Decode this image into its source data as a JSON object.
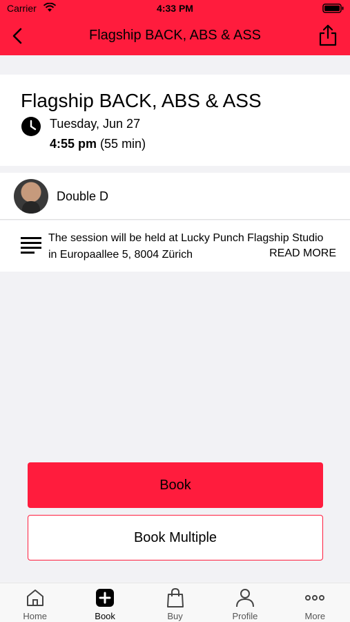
{
  "status_bar": {
    "carrier": "Carrier",
    "time": "4:33 PM"
  },
  "nav": {
    "title": "Flagship BACK, ABS & ASS"
  },
  "event": {
    "title": "Flagship BACK, ABS & ASS",
    "date": "Tuesday, Jun 27",
    "time": "4:55 pm",
    "duration": "(55 min)"
  },
  "instructor": {
    "name": "Double D"
  },
  "description": {
    "text": "The session will be held at Lucky Punch Flagship Studio in Europaallee 5, 8004 Zürich",
    "read_more": "READ MORE"
  },
  "buttons": {
    "book": "Book",
    "book_multiple": "Book Multiple"
  },
  "tabs": [
    {
      "label": "Home",
      "icon": "home-icon"
    },
    {
      "label": "Book",
      "icon": "plus-square-icon"
    },
    {
      "label": "Buy",
      "icon": "shopping-bag-icon"
    },
    {
      "label": "Profile",
      "icon": "person-icon"
    },
    {
      "label": "More",
      "icon": "more-dots-icon"
    }
  ],
  "colors": {
    "accent": "#ff1c3d",
    "background": "#f2f2f5"
  }
}
